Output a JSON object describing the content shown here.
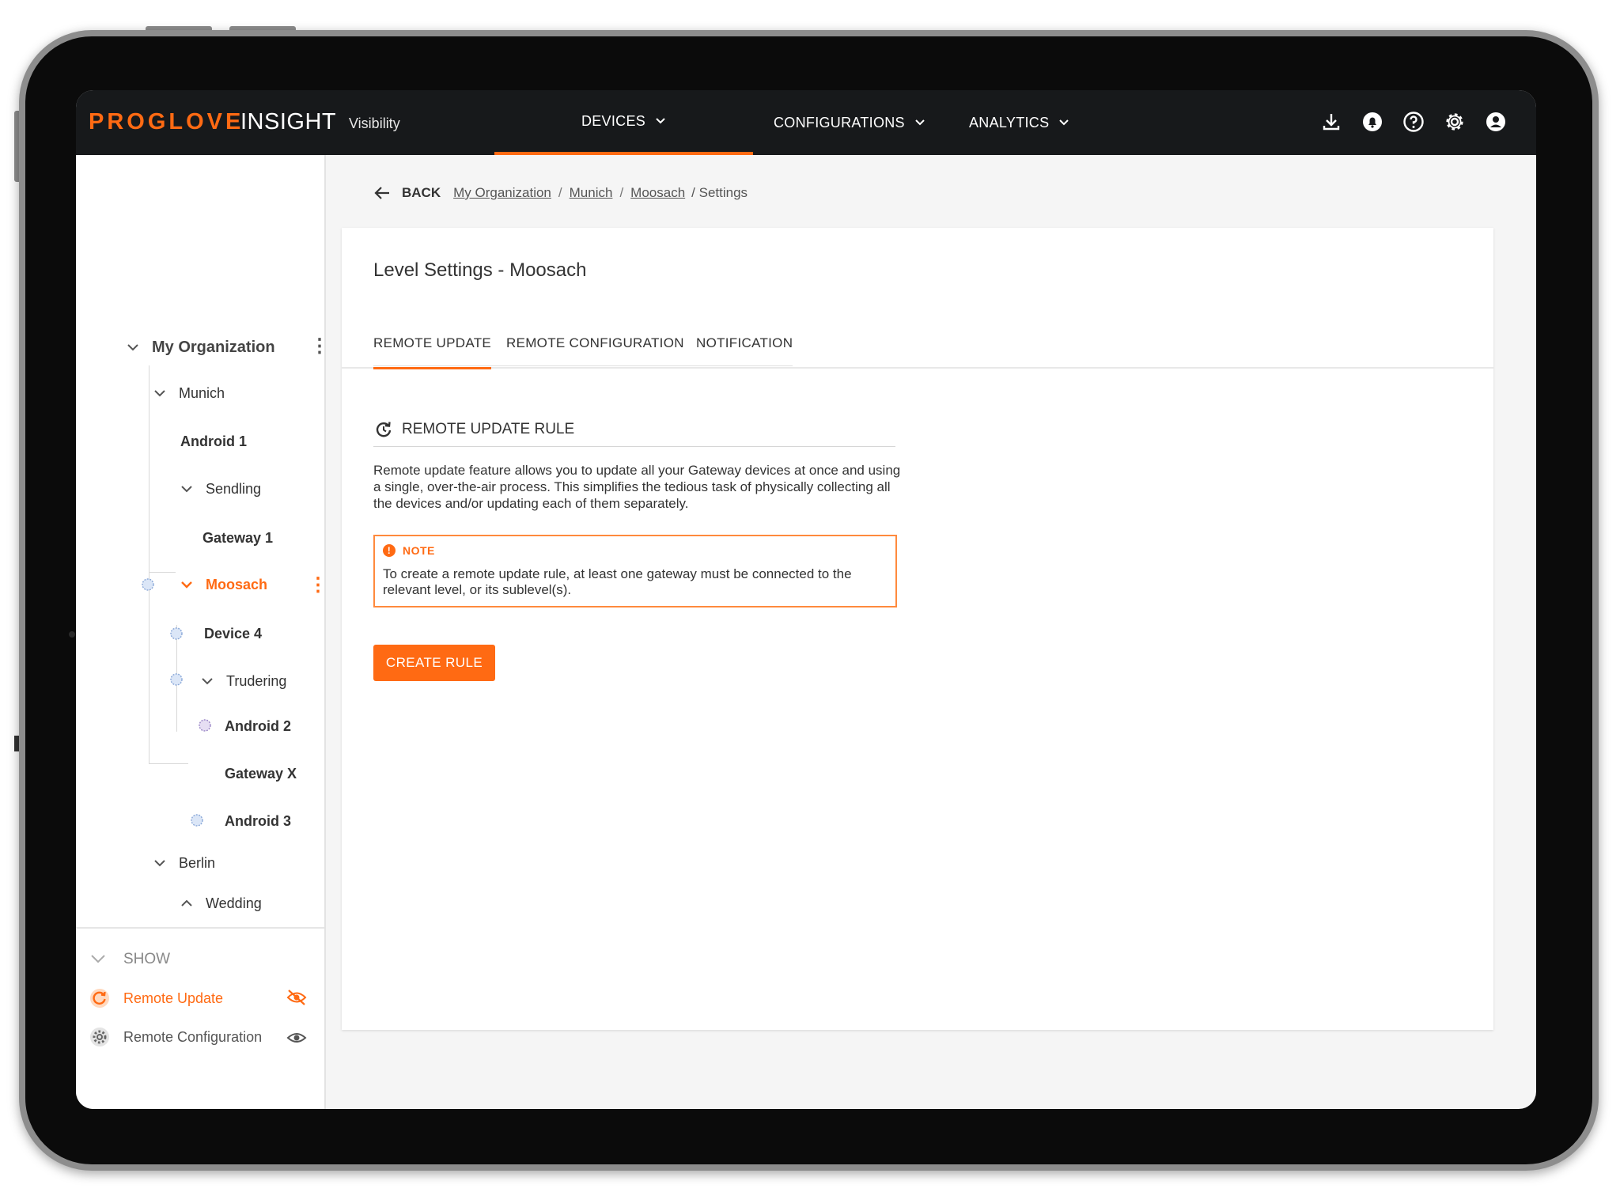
{
  "app": {
    "brand_primary": "PROGLOVE",
    "brand_secondary": "INSIGHT",
    "section": "Visibility",
    "accent_color": "#ff6a13"
  },
  "nav": {
    "devices": "DEVICES",
    "configurations": "CONFIGURATIONS",
    "analytics": "ANALYTICS"
  },
  "top_icons": [
    "download-icon",
    "bell-icon",
    "help-icon",
    "settings-icon",
    "account-icon"
  ],
  "sidebar": {
    "tree": {
      "root": "My Organization",
      "munich": "Munich",
      "android1": "Android 1",
      "sendling": "Sendling",
      "gateway1": "Gateway 1",
      "moosach": "Moosach",
      "device4": "Device 4",
      "trudering": "Trudering",
      "android2": "Android 2",
      "gatewayx": "Gateway X",
      "android3": "Android 3",
      "berlin": "Berlin",
      "wedding": "Wedding"
    },
    "show": {
      "label": "SHOW",
      "remote_update": "Remote Update",
      "remote_configuration": "Remote Configuration"
    }
  },
  "breadcrumb": {
    "back": "BACK",
    "items": [
      "My Organization",
      "Munich",
      "Moosach"
    ],
    "current": "/ Settings"
  },
  "main": {
    "title": "Level Settings - Moosach",
    "tabs": [
      "REMOTE UPDATE",
      "REMOTE CONFIGURATION",
      "NOTIFICATION"
    ],
    "rule_title": "REMOTE UPDATE RULE",
    "description": "Remote update feature allows you to update all your Gateway devices at once and using a single, over-the-air process. This simplifies the tedious task of physically collecting all the devices and/or updating each of them separately.",
    "note_label": "NOTE",
    "note_text": "To create a remote update rule, at least one gateway must be connected to the relevant level, or its sublevel(s).",
    "create_button": "CREATE RULE"
  }
}
